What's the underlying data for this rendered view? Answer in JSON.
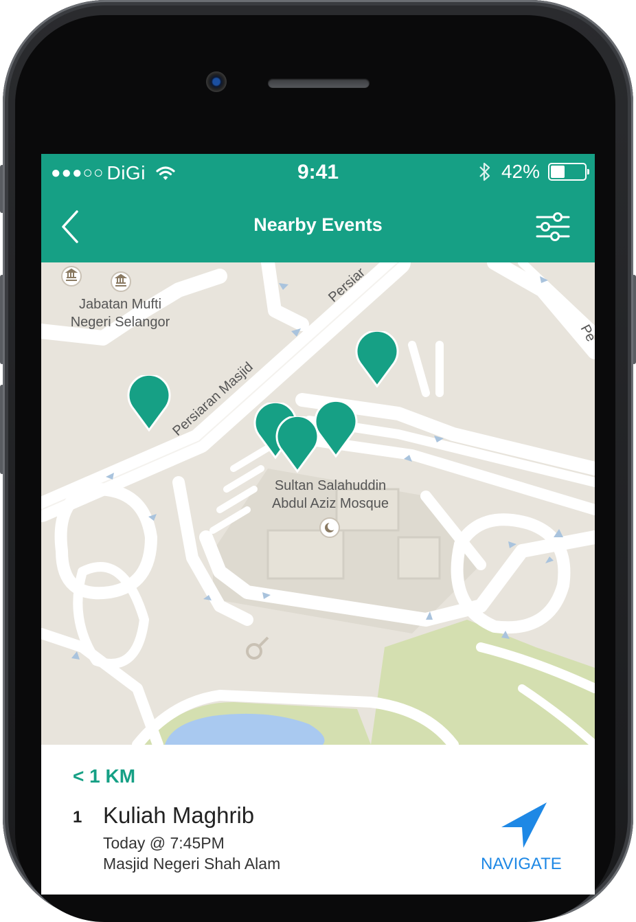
{
  "status_bar": {
    "signal_dots": "●●●○○",
    "carrier": "DiGi",
    "time": "9:41",
    "battery_percent": "42%",
    "battery_level": 0.42
  },
  "nav": {
    "title": "Nearby Events",
    "back_icon": "chevron-left-icon",
    "filter_icon": "sliders-icon"
  },
  "map": {
    "labels": {
      "agency": "Jabatan Mufti\nNegeri Selangor",
      "mosque": "Sultan Salahuddin\nAbdul Aziz Mosque",
      "road_main": "Persiaran Masjid",
      "road_top": "Persiar",
      "road_right": "Pe"
    }
  },
  "event": {
    "distance": "< 1 KM",
    "index": "1",
    "title": "Kuliah Maghrib",
    "time": "Today @ 7:45PM",
    "place": "Masjid Negeri Shah Alam",
    "navigate_label": "NAVIGATE"
  },
  "colors": {
    "accent": "#16a085",
    "link": "#1e88e5"
  }
}
